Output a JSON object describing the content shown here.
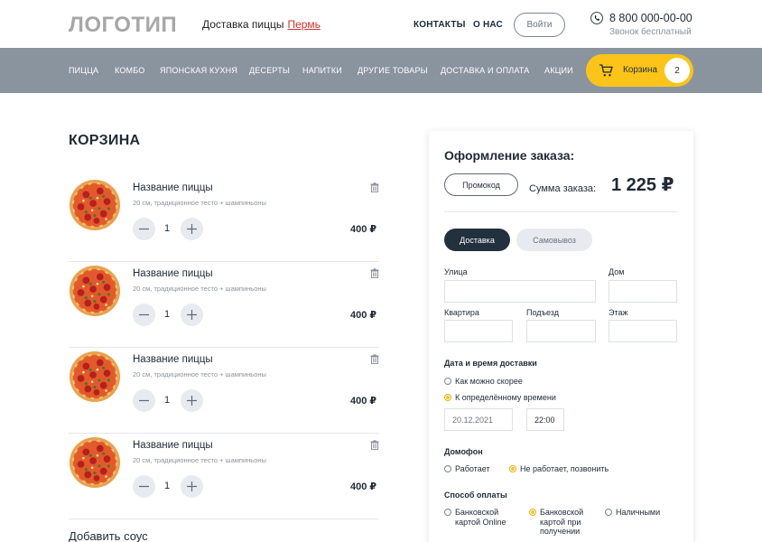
{
  "header": {
    "logo": "ЛОГОТИП",
    "delivery_text": "Доставка пиццы",
    "city": "Пермь",
    "links": [
      "КОНТАКТЫ",
      "О НАС"
    ],
    "login_label": "Войти",
    "phone": "8 800 000-00-00",
    "phone_sub": "Звонок бесплатный"
  },
  "nav": {
    "items": [
      "ПИЦЦА",
      "КОМБО",
      "ЯПОНСКАЯ КУХНЯ",
      "ДЕСЕРТЫ",
      "НАПИТКИ",
      "ДРУГИЕ ТОВАРЫ",
      "ДОСТАВКА И ОПЛАТА",
      "АКЦИИ"
    ],
    "cart_label": "Корзина",
    "cart_count": "2"
  },
  "cart": {
    "title": "КОРЗИНА",
    "items": [
      {
        "name": "Название пиццы",
        "desc": "20 см, традиционное тесто + шампиньоны",
        "qty": "1",
        "price": "400 ₽"
      },
      {
        "name": "Название пиццы",
        "desc": "20 см, традиционное тесто + шампиньоны",
        "qty": "1",
        "price": "400 ₽"
      },
      {
        "name": "Название пиццы",
        "desc": "20 см, традиционное тесто + шампиньоны",
        "qty": "1",
        "price": "400 ₽"
      },
      {
        "name": "Название пиццы",
        "desc": "20 см, традиционное тесто + шампиньоны",
        "qty": "1",
        "price": "400 ₽"
      }
    ],
    "add_sauce": "Добавить соус"
  },
  "order": {
    "title": "Оформление заказа:",
    "promo_label": "Промокод",
    "sum_label": "Сумма заказа:",
    "sum_value": "1 225 ₽",
    "tab_delivery": "Доставка",
    "tab_pickup": "Самовывоз",
    "fields": {
      "street": "Улица",
      "house": "Дом",
      "apartment": "Квартира",
      "entrance": "Подъезд",
      "floor": "Этаж"
    },
    "datetime": {
      "title": "Дата и время доставки",
      "asap": "Как можно скорее",
      "scheduled": "К определённому времени",
      "date_value": "20.12.2021",
      "time_value": "22:00"
    },
    "intercom": {
      "title": "Домофон",
      "works": "Работает",
      "broken": "Не работает, позвонить"
    },
    "payment": {
      "title": "Способ оплаты",
      "card_online": "Банковской картой Online",
      "card_courier": "Банковской картой при получении",
      "cash": "Наличными"
    }
  },
  "colors": {
    "accent": "#fcc419",
    "nav_bg": "#8a949f",
    "dark": "#23303e",
    "city_link": "#d6302a"
  }
}
